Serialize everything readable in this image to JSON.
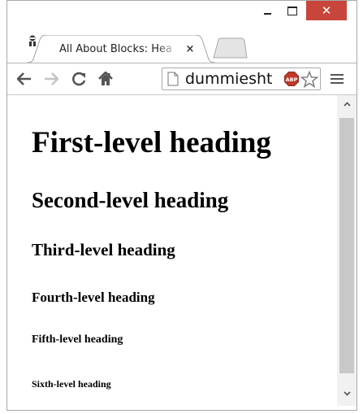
{
  "window": {
    "minimize_symbol": "",
    "close_symbol": "✕"
  },
  "tab": {
    "title": "All About Blocks: Hea",
    "close_symbol": "×",
    "favicon": "dummies-man-icon"
  },
  "toolbar": {
    "back_icon": "back-arrow-icon",
    "forward_icon": "forward-arrow-icon",
    "reload_icon": "reload-icon",
    "home_icon": "home-icon",
    "address_text": "dummiesht",
    "adblock_icon": "abp-icon",
    "bookmark_icon": "star-icon",
    "menu_icon": "hamburger-menu-icon"
  },
  "content": {
    "h1": "First-level heading",
    "h2": "Second-level heading",
    "h3": "Third-level heading",
    "h4": "Fourth-level heading",
    "h5": "Fifth-level heading",
    "h6": "Sixth-level heading"
  },
  "colors": {
    "close_button": "#c7453a",
    "scrollbar_thumb": "#c8c8c8",
    "abp_badge": "#c0392b"
  }
}
